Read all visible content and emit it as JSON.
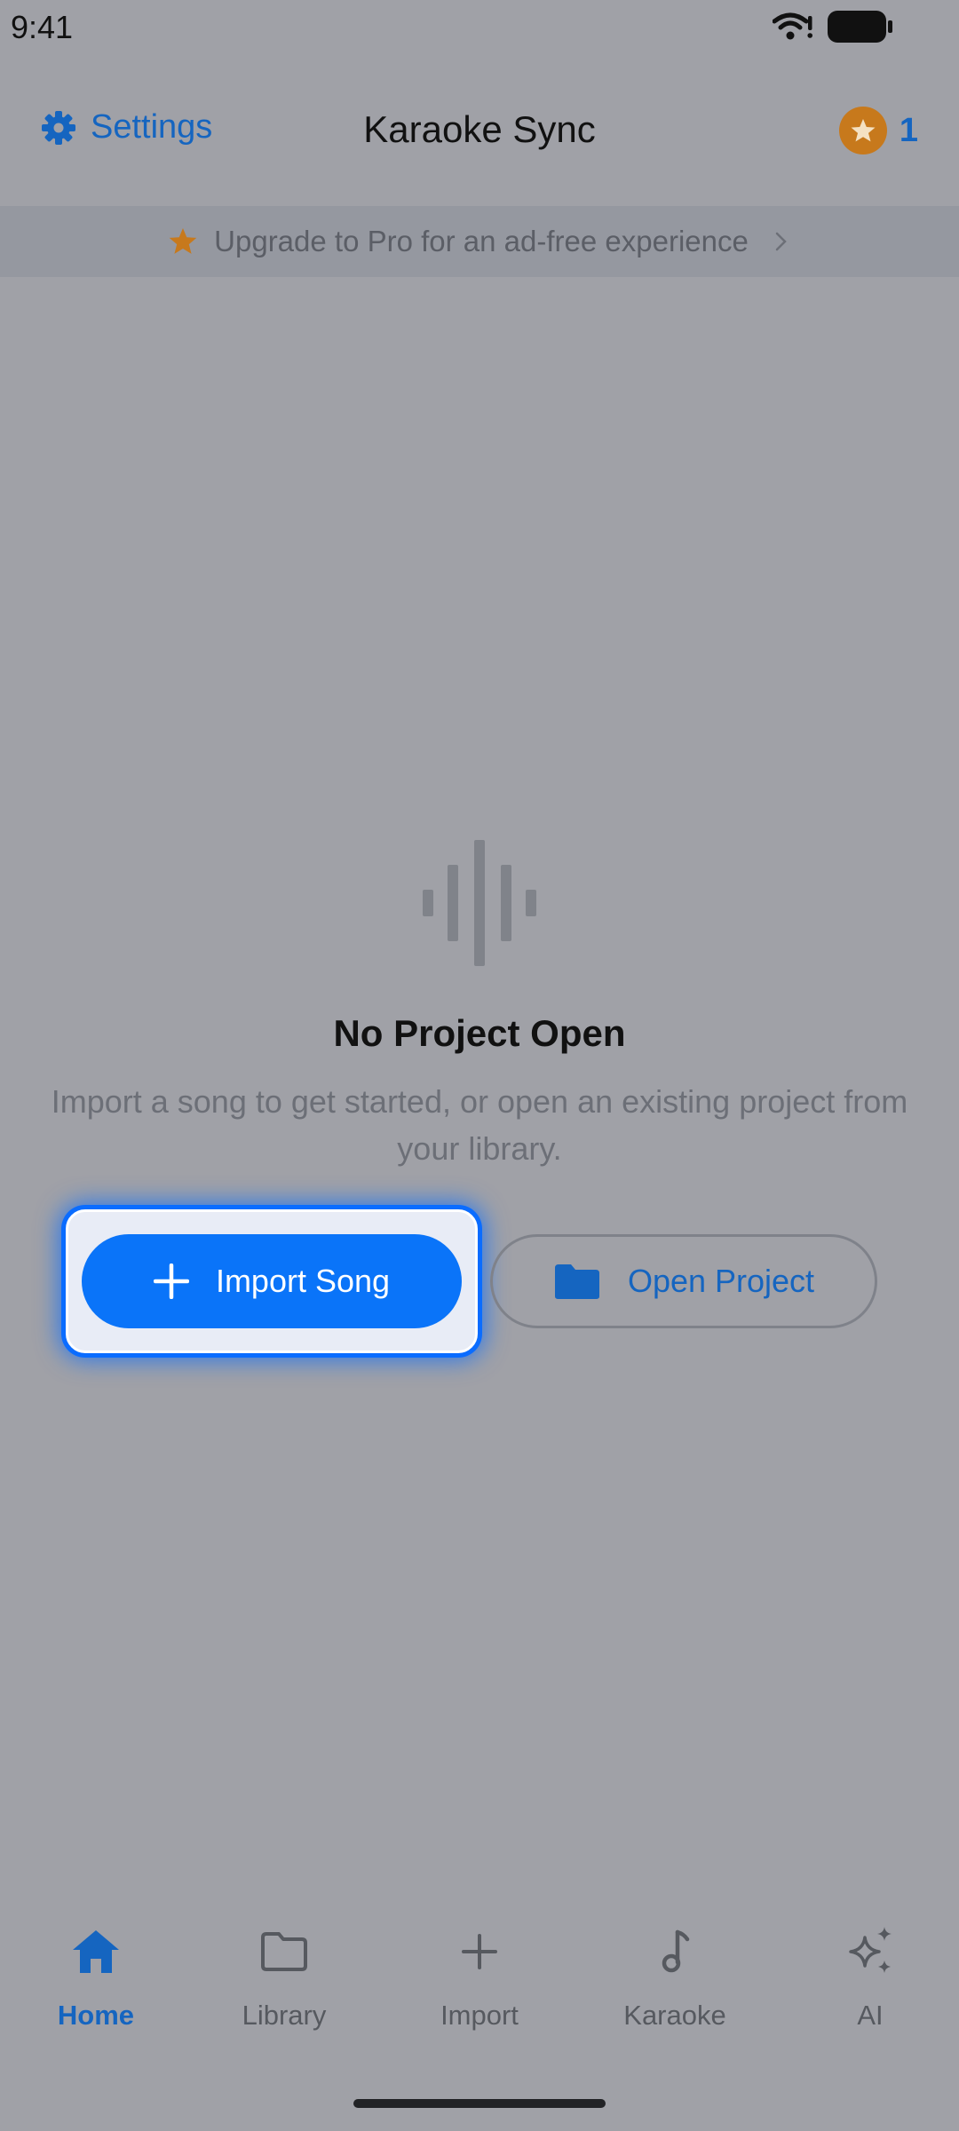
{
  "status_bar": {
    "time": "9:41",
    "wifi_icon": "wifi-icon",
    "battery_icon": "battery-icon"
  },
  "header": {
    "settings_label": "Settings",
    "settings_icon": "gear-icon",
    "title": "Karaoke Sync",
    "credits_icon": "star-coin-icon",
    "credits_count": "1"
  },
  "banner": {
    "text": "Upgrade to Pro for an ad-free experience",
    "icon": "star-icon"
  },
  "empty_state": {
    "icon": "waveform-icon",
    "title": "No Project Open",
    "description": "Import a song to get started, or open an existing project from your library."
  },
  "actions": {
    "import_song": "Import Song",
    "open_project": "Open Project"
  },
  "nav": {
    "items": [
      {
        "label": "Home",
        "icon": "home-icon",
        "active": true
      },
      {
        "label": "Library",
        "icon": "folder-icon",
        "active": false
      },
      {
        "label": "Import",
        "icon": "plus-icon",
        "active": false
      },
      {
        "label": "Karaoke",
        "icon": "music-note-icon",
        "active": false
      },
      {
        "label": "AI",
        "icon": "sparkles-icon",
        "active": false
      }
    ]
  },
  "colors": {
    "accent": "#1565c0",
    "primary_button": "#0a74f9",
    "highlight": "#0a6cff",
    "coin": "#c7791c",
    "overlay": "#a0a1a7"
  }
}
